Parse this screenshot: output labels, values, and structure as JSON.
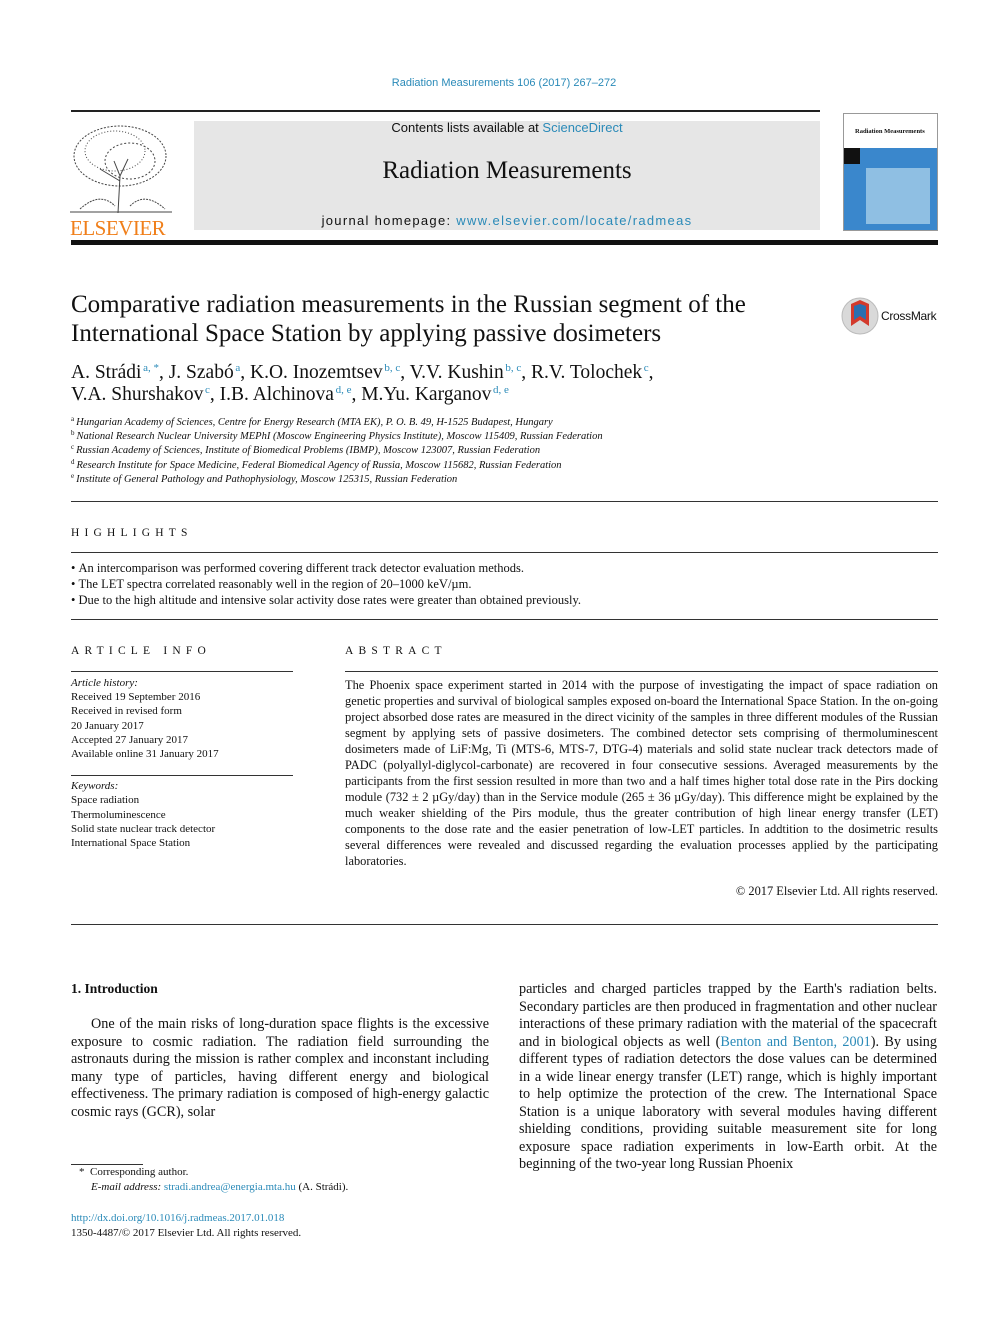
{
  "header": {
    "citation": "Radiation Measurements 106 (2017) 267–272",
    "contents_prefix": "Contents lists available at ",
    "contents_link": "ScienceDirect",
    "journal_title": "Radiation Measurements",
    "homepage_prefix": "journal homepage: ",
    "homepage_link": "www.elsevier.com/locate/radmeas",
    "publisher_logo_text": "ELSEVIER",
    "cover_title": "Radiation Measurements",
    "crossmark_label": "CrossMark",
    "colors": {
      "link": "#2a8ab8",
      "elsevier_orange": "#f07f1a",
      "banner_bg": "#e6e6e6",
      "cover_blue": "#3a87cc"
    }
  },
  "article": {
    "title": "Comparative radiation measurements in the Russian segment of the International Space Station by applying passive dosimeters",
    "authors": [
      {
        "name": "A. Strádi",
        "sup": "a, *"
      },
      {
        "name": "J. Szabó",
        "sup": "a"
      },
      {
        "name": "K.O. Inozemtsev",
        "sup": "b, c"
      },
      {
        "name": "V.V. Kushin",
        "sup": "b, c"
      },
      {
        "name": "R.V. Tolochek",
        "sup": "c"
      },
      {
        "name": "V.A. Shurshakov",
        "sup": "c"
      },
      {
        "name": "I.B. Alchinova",
        "sup": "d, e"
      },
      {
        "name": "M.Yu. Karganov",
        "sup": "d, e"
      }
    ],
    "affiliations": [
      {
        "key": "a",
        "text": "Hungarian Academy of Sciences, Centre for Energy Research (MTA EK), P. O. B. 49, H-1525 Budapest, Hungary"
      },
      {
        "key": "b",
        "text": "National Research Nuclear University MEPhI (Moscow Engineering Physics Institute), Moscow 115409, Russian Federation"
      },
      {
        "key": "c",
        "text": "Russian Academy of Sciences, Institute of Biomedical Problems (IBMP), Moscow 123007, Russian Federation"
      },
      {
        "key": "d",
        "text": "Research Institute for Space Medicine, Federal Biomedical Agency of Russia, Moscow 115682, Russian Federation"
      },
      {
        "key": "e",
        "text": "Institute of General Pathology and Pathophysiology, Moscow 125315, Russian Federation"
      }
    ]
  },
  "highlights": {
    "heading": "HIGHLIGHTS",
    "items": [
      "An intercomparison was performed covering different track detector evaluation methods.",
      "The LET spectra correlated reasonably well in the region of 20–1000 keV/µm.",
      "Due to the high altitude and intensive solar activity dose rates were greater than obtained previously."
    ]
  },
  "article_info": {
    "heading": "ARTICLE INFO",
    "history_label": "Article history:",
    "history": [
      "Received 19 September 2016",
      "Received in revised form",
      "20 January 2017",
      "Accepted 27 January 2017",
      "Available online 31 January 2017"
    ],
    "keywords_label": "Keywords:",
    "keywords": [
      "Space radiation",
      "Thermoluminescence",
      "Solid state nuclear track detector",
      "International Space Station"
    ]
  },
  "abstract": {
    "heading": "ABSTRACT",
    "text": "The Phoenix space experiment started in 2014 with the purpose of investigating the impact of space radiation on genetic properties and survival of biological samples exposed on-board the International Space Station. In the on-going project absorbed dose rates are measured in the direct vicinity of the samples in three different modules of the Russian segment by applying sets of passive dosimeters. The combined detector sets comprising of thermoluminescent dosimeters made of LiF:Mg, Ti (MTS-6, MTS-7, DTG-4) materials and solid state nuclear track detectors made of PADC (polyallyl-diglycol-carbonate) are recovered in four consecutive sessions. Averaged measurements by the participants from the first session resulted in more than two and a half times higher total dose rate in the Pirs docking module (732 ± 2 µGy/day) than in the Service module (265 ± 36 µGy/day). This difference might be explained by the much weaker shielding of the Pirs module, thus the greater contribution of high linear energy transfer (LET) components to the dose rate and the easier penetration of low-LET particles. In addtition to the dosimetric results several differences were revealed and discussed regarding the evaluation processes applied by the participating laboratories.",
    "copyright": "© 2017 Elsevier Ltd. All rights reserved."
  },
  "intro": {
    "heading": "1.  Introduction",
    "left": "One of the main risks of long-duration space flights is the excessive exposure to cosmic radiation. The radiation field surrounding the astronauts during the mission is rather complex and inconstant including many type of particles, having different energy and biological effectiveness. The primary radiation is composed of high-energy galactic cosmic rays (GCR), solar",
    "right_pre": "particles and charged particles trapped by the Earth's radiation belts. Secondary particles are then produced in fragmentation and other nuclear interactions of these primary radiation with the material of the spacecraft and in biological objects as well (",
    "right_link": "Benton and Benton, 2001",
    "right_post": "). By using different types of radiation detectors the dose values can be determined in a wide linear energy transfer (LET) range, which is highly important to help optimize the protection of the crew. The International Space Station is a unique laboratory with several modules having different shielding conditions, providing suitable measurement site for long exposure space radiation experiments in low-Earth orbit. At the beginning of the two-year long Russian Phoenix"
  },
  "footnote": {
    "marker": "*",
    "corresponding": "Corresponding author.",
    "email_label": "E-mail address: ",
    "email": "stradi.andrea@energia.mta.hu",
    "email_suffix": " (A. Strádi).",
    "doi": "http://dx.doi.org/10.1016/j.radmeas.2017.01.018",
    "issn": "1350-4487/© 2017 Elsevier Ltd. All rights reserved."
  }
}
